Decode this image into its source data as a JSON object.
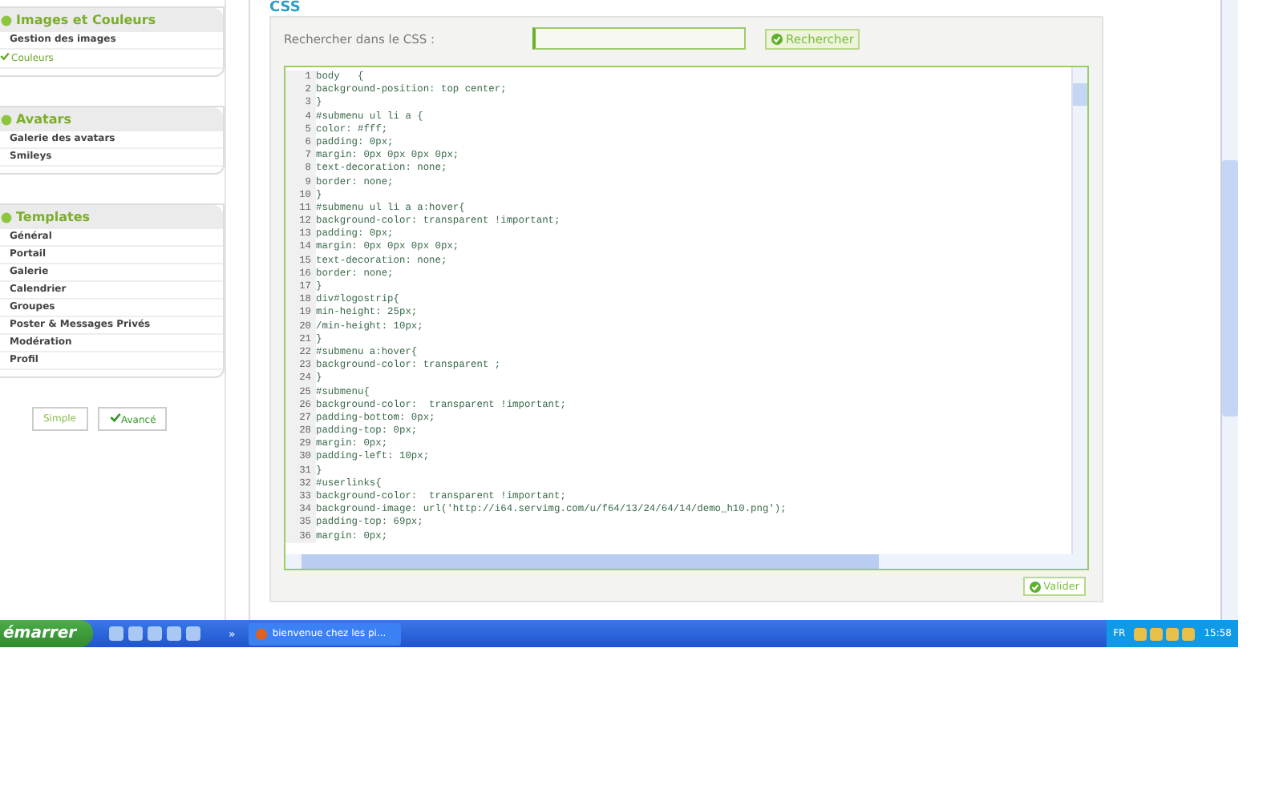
{
  "sidebar": {
    "groups": [
      {
        "title": "Images et Couleurs",
        "items": [
          {
            "label": "Gestion des images",
            "selected": false
          },
          {
            "label": "Couleurs",
            "selected": true
          }
        ]
      },
      {
        "title": "Avatars",
        "items": [
          {
            "label": "Galerie des avatars",
            "selected": false
          },
          {
            "label": "Smileys",
            "selected": false
          }
        ]
      },
      {
        "title": "Templates",
        "items": [
          {
            "label": "Général",
            "selected": false
          },
          {
            "label": "Portail",
            "selected": false
          },
          {
            "label": "Galerie",
            "selected": false
          },
          {
            "label": "Calendrier",
            "selected": false
          },
          {
            "label": "Groupes",
            "selected": false
          },
          {
            "label": "Poster & Messages Privés",
            "selected": false
          },
          {
            "label": "Modération",
            "selected": false
          },
          {
            "label": "Profil",
            "selected": false
          }
        ]
      }
    ],
    "modes": [
      {
        "label": "Simple",
        "selected": false
      },
      {
        "label": "Avancé",
        "selected": true
      }
    ]
  },
  "panel": {
    "title": "CSS",
    "search_label": "Rechercher dans le CSS :",
    "search_button": "Rechercher",
    "submit_button": "Valider",
    "code_lines": [
      {
        "num": "1",
        "text": "body   {"
      },
      {
        "num": "2",
        "text": "background-position: top center;"
      },
      {
        "num": "3",
        "text": "}"
      },
      {
        "num": "4",
        "text": "#submenu ul li a {"
      },
      {
        "num": "5",
        "text": "color: #fff;"
      },
      {
        "num": "6",
        "text": "padding: 0px;"
      },
      {
        "num": "7",
        "text": "margin: 0px 0px 0px 0px;"
      },
      {
        "num": "8",
        "text": "text-decoration: none;"
      },
      {
        "num": "9",
        "text": "border: none;"
      },
      {
        "num": "10",
        "text": "}"
      },
      {
        "num": "11",
        "text": "#submenu ul li a a:hover{"
      },
      {
        "num": "12",
        "text": "background-color: transparent !important;"
      },
      {
        "num": "13",
        "text": "padding: 0px;"
      },
      {
        "num": "14",
        "text": "margin: 0px 0px 0px 0px;"
      },
      {
        "num": "15",
        "text": "text-decoration: none;"
      },
      {
        "num": "16",
        "text": "border: none;"
      },
      {
        "num": "17",
        "text": "}"
      },
      {
        "num": "18",
        "text": "div#logostrip{"
      },
      {
        "num": "19",
        "text": "min-height: 25px;"
      },
      {
        "num": "20",
        "text": "/min-height: 10px;"
      },
      {
        "num": "21",
        "text": "}"
      },
      {
        "num": "22",
        "text": "#submenu a:hover{"
      },
      {
        "num": "23",
        "text": "background-color: transparent ;"
      },
      {
        "num": "24",
        "text": "}"
      },
      {
        "num": "25",
        "text": "#submenu{"
      },
      {
        "num": "26",
        "text": "background-color:  transparent !important;"
      },
      {
        "num": "27",
        "text": "padding-bottom: 0px;"
      },
      {
        "num": "28",
        "text": "padding-top: 0px;"
      },
      {
        "num": "29",
        "text": "margin: 0px;"
      },
      {
        "num": "30",
        "text": "padding-left: 10px;"
      },
      {
        "num": "31",
        "text": "}"
      },
      {
        "num": "32",
        "text": "#userlinks{"
      },
      {
        "num": "33",
        "text": "background-color:  transparent !important;"
      },
      {
        "num": "34",
        "text": "background-image: url('http://i64.servimg.com/u/f64/13/24/64/14/demo_h10.png');"
      },
      {
        "num": "35",
        "text": "padding-top: 69px;"
      },
      {
        "num": "36",
        "text": "margin: 0px;"
      }
    ]
  },
  "taskbar": {
    "start": "émarrer",
    "overflow": "»",
    "tasks": [
      {
        "label": "bienvenue chez les pi...",
        "selected": false
      }
    ],
    "language": "FR",
    "clock": "15:58"
  }
}
